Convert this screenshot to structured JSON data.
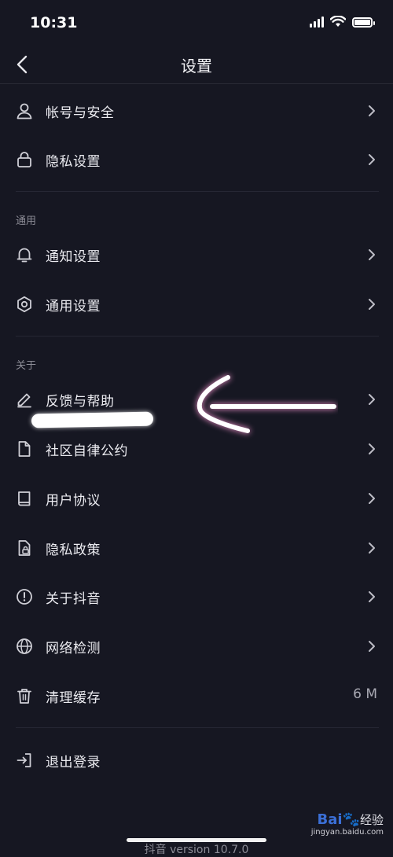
{
  "status_bar": {
    "time": "10:31"
  },
  "nav": {
    "title": "设置"
  },
  "sections": {
    "about_header": "关于",
    "general_header": "通用"
  },
  "items": {
    "account": {
      "label": "帐号与安全",
      "icon": "person-icon"
    },
    "privacy_settings": {
      "label": "隐私设置",
      "icon": "lock-icon"
    },
    "notifications": {
      "label": "通知设置",
      "icon": "bell-icon"
    },
    "general": {
      "label": "通用设置",
      "icon": "gear-icon"
    },
    "feedback": {
      "label": "反馈与帮助",
      "icon": "pencil-icon"
    },
    "community": {
      "label": "社区自律公约",
      "icon": "document-icon"
    },
    "user_agreement": {
      "label": "用户协议",
      "icon": "book-icon"
    },
    "privacy_policy": {
      "label": "隐私政策",
      "icon": "lock-document-icon"
    },
    "about": {
      "label": "关于抖音",
      "icon": "info-icon"
    },
    "network": {
      "label": "网络检测",
      "icon": "globe-icon"
    },
    "clear_cache": {
      "label": "清理缓存",
      "icon": "trash-icon",
      "value": "6 M"
    },
    "logout": {
      "label": "退出登录",
      "icon": "logout-icon"
    }
  },
  "footer": {
    "version": "抖音 version 10.7.0"
  },
  "watermark": {
    "logo": "Bai",
    "logo_suffix": "经验",
    "url": "jingyan.baidu.com"
  },
  "colors": {
    "background": "#161722",
    "text": "#ececf1",
    "muted": "#8c8c96",
    "divider": "#262734"
  }
}
